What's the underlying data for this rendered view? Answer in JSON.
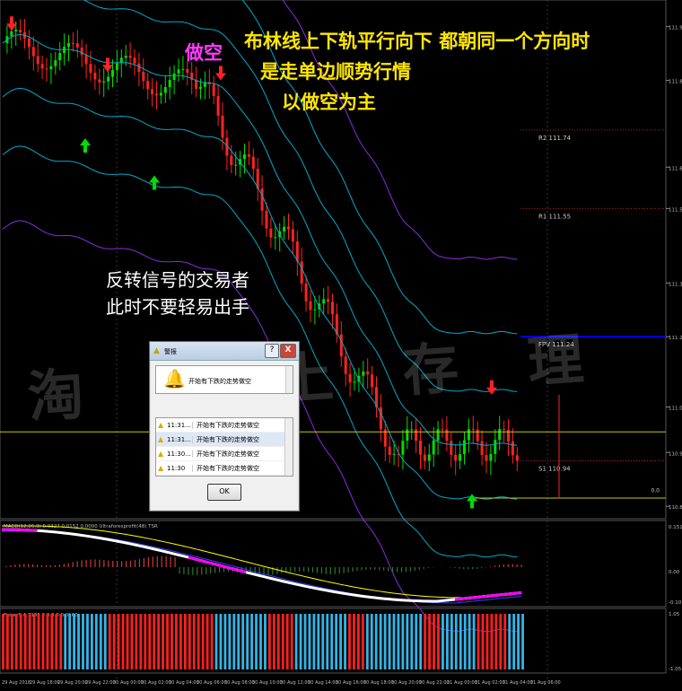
{
  "colors": {
    "background": "#000000",
    "bull": "#00dd00",
    "bear": "#ff2222",
    "bb_mid": "#00aacc",
    "bb_outer": "#8a2be2",
    "pivot_line": "#0000ff",
    "level_dot": "#b22222",
    "macd_up": "#ffffff",
    "macd_dn": "#ff00ff",
    "signal": "#ffff00",
    "hist_blue": "#33b5e5",
    "hist_red": "#ff2020"
  },
  "annotations": {
    "headline": [
      "布林线上下轨平行向下 都朝同一个方向时",
      "是走单边顺势行情",
      "以做空为主"
    ],
    "short_label": "做空",
    "note": [
      "反转信号的交易者",
      "此时不要轻易出手"
    ],
    "watermark": "淘 汇 上 存 理"
  },
  "chart_data": [
    {
      "type": "candlestick",
      "levels": [
        {
          "name": "R2",
          "value": 111.74
        },
        {
          "name": "R1",
          "value": 111.55
        },
        {
          "name": "FPV",
          "value": 111.24
        },
        {
          "name": "S1",
          "value": 110.94
        }
      ],
      "signals": [
        "sell",
        "sell",
        "buy",
        "buy",
        "sell",
        "sell",
        "buy"
      ],
      "right_axis_ticks": [
        "111.99",
        "111.86",
        "111.65",
        "111.55",
        "111.37",
        "111.24",
        "111.07",
        "110.96",
        "110.83"
      ],
      "last_label": "0.0",
      "x_ticks": [
        "29 Aug 2018",
        "29 Aug 18:00",
        "29 Aug 20:00",
        "29 Aug 22:00",
        "30 Aug 00:00",
        "30 Aug 02:00",
        "30 Aug 04:00",
        "30 Aug 06:00",
        "30 Aug 08:00",
        "30 Aug 10:00",
        "30 Aug 12:00",
        "30 Aug 14:00",
        "30 Aug 16:00",
        "30 Aug 18:00",
        "30 Aug 20:00",
        "30 Aug 22:00",
        "31 Aug 00:00",
        "31 Aug 02:00",
        "31 Aug 04:00",
        "31 Aug 06:00"
      ]
    },
    {
      "type": "line",
      "title": "MACD(12,26,9) 0.0327 0.0152 0.0000  Ultraforesprofit(48)  TSR",
      "right_axis_ticks": [
        "0.1517",
        "0.00",
        "-0.1077"
      ]
    },
    {
      "type": "bar",
      "title": "FisherS 4.7188 0.0.0.0 0.0160",
      "right_axis_ticks": [
        "1.05",
        "-1.05"
      ]
    }
  ],
  "dialog": {
    "title": "警报",
    "help_label": "?",
    "close_label": "X",
    "message": "开始有下跌的走势做空",
    "rows": [
      {
        "time": "11:31...",
        "msg": "开始有下跌的走势做空"
      },
      {
        "time": "11:31...",
        "msg": "开始有下跌的走势做空"
      },
      {
        "time": "11:30...",
        "msg": "开始有下跌的走势做空"
      },
      {
        "time": "11:30",
        "msg": "开始有下跌的走势做空"
      }
    ],
    "ok_label": "OK"
  }
}
